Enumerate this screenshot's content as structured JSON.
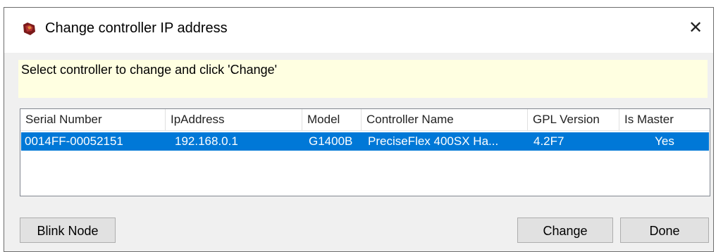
{
  "window": {
    "title": "Change controller IP address",
    "close_glyph": "✕"
  },
  "instruction": "Select controller to change and click 'Change'",
  "table": {
    "columns": [
      "Serial Number",
      "IpAddress",
      "Model",
      "Controller Name",
      "GPL Version",
      "Is Master"
    ],
    "rows": [
      {
        "serial": "0014FF-00052151",
        "ip": "192.168.0.1",
        "model": "G1400B",
        "name": "PreciseFlex 400SX Ha...",
        "gpl": "4.2F7",
        "master": "Yes",
        "selected": true
      }
    ]
  },
  "buttons": {
    "blink": "Blink Node",
    "change": "Change",
    "done": "Done"
  },
  "colors": {
    "selection": "#0078d7",
    "instruction_bg": "#ffffe1",
    "window_bg": "#f0f0f0"
  }
}
